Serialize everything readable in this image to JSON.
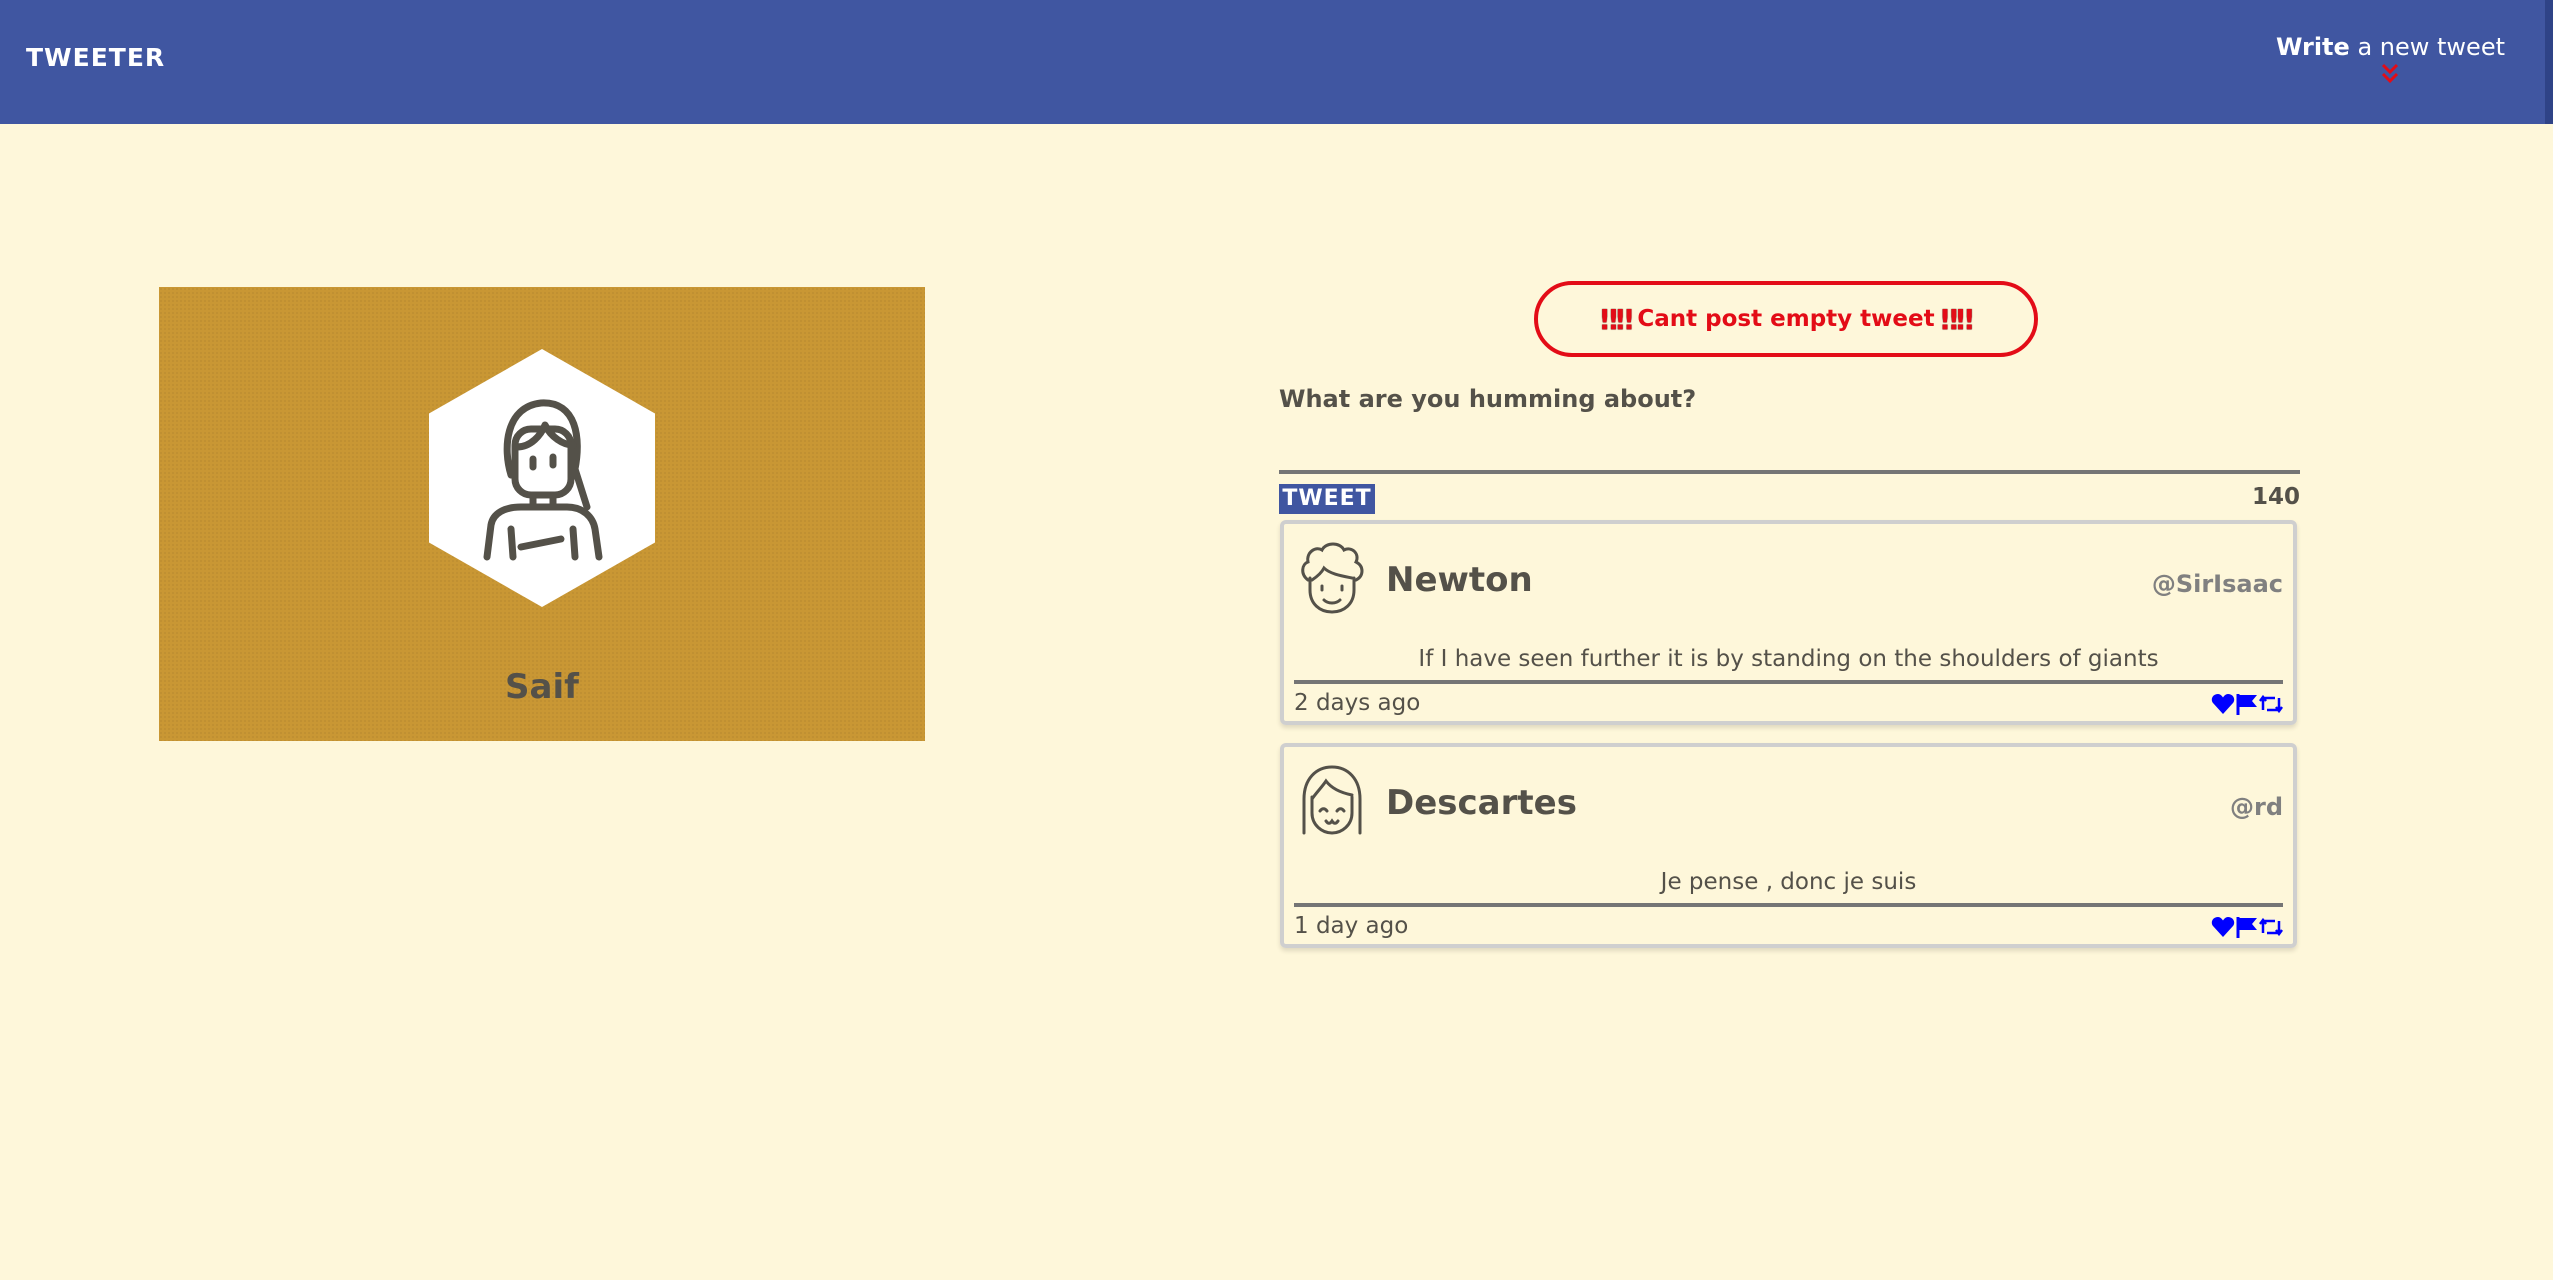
{
  "nav": {
    "brand": "TWEETER",
    "compose_bold": "Write",
    "compose_rest": " a new tweet"
  },
  "profile": {
    "name": "Saif"
  },
  "composer": {
    "error_text": "Cant post empty tweet",
    "error_marks": "‼‼",
    "prompt": "What are you humming about?",
    "button_label": "TWEET",
    "counter": "140"
  },
  "tweets": [
    {
      "name": "Newton",
      "handle": "@SirIsaac",
      "content": "If I have seen further it is by standing on the shoulders of giants",
      "age": "2 days ago"
    },
    {
      "name": "Descartes",
      "handle": "@rd",
      "content": "Je pense , donc je suis",
      "age": "1 day ago"
    }
  ],
  "colors": {
    "nav": "#4056a1",
    "background": "#fef7da",
    "profile_card": "#c99734",
    "error": "#e30c17",
    "action_icons": "#0000ff"
  },
  "icons": {
    "compose": "double-chevron-down-icon",
    "actions": [
      "heart-icon",
      "flag-icon",
      "retweet-icon"
    ]
  }
}
